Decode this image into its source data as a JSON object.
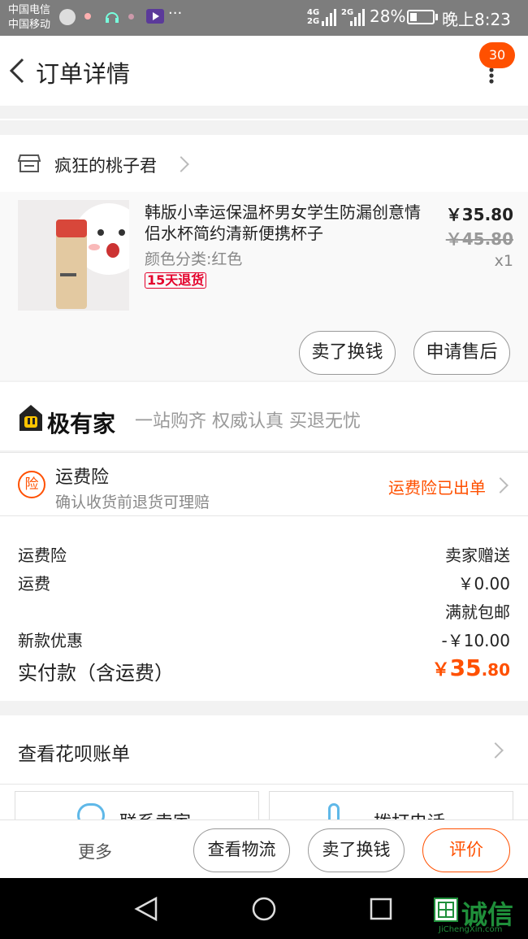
{
  "statusbar": {
    "carrier1": "中国电信",
    "carrier2": "中国移动",
    "network1": "4G",
    "network1b": "2G",
    "network2": "2G",
    "battery": "28%",
    "time": "晚上8:23"
  },
  "header": {
    "title": "订单详情",
    "badge_count": "30"
  },
  "shop": {
    "name": "疯狂的桃子君"
  },
  "product": {
    "title": "韩版小幸运保温杯男女学生防漏创意情侣水杯简约清新便携杯子",
    "variant": "颜色分类:红色",
    "return_tag": "15天退货",
    "price": "￥35.80",
    "original_price": "￥45.80",
    "quantity": "x1"
  },
  "product_actions": {
    "exchange": "卖了换钱",
    "after_sale": "申请售后"
  },
  "brand_banner": {
    "name": "极有家",
    "slogan": "一站购齐 权威认真 买退无忧"
  },
  "insurance": {
    "icon_char": "险",
    "title": "运费险",
    "subtitle": "确认收货前退货可理赔",
    "status": "运费险已出单"
  },
  "costs": {
    "rows": [
      {
        "label": "运费险",
        "value": "卖家赠送"
      },
      {
        "label": "运费",
        "value": "￥0.00"
      },
      {
        "label": "",
        "value": "满就包邮"
      },
      {
        "label": "新款优惠",
        "value": "-￥10.00"
      }
    ],
    "total_label": "实付款（含运费）",
    "total_currency": "￥",
    "total_int": "35",
    "total_dec": ".80"
  },
  "huabei": {
    "label": "查看花呗账单"
  },
  "contact": {
    "seller": "联系卖家",
    "call": "拨打电话"
  },
  "bottom_bar": {
    "more": "更多",
    "logistics": "查看物流",
    "exchange": "卖了换钱",
    "review": "评价"
  },
  "watermark": {
    "text": "诚信",
    "url": "JiChengXin.com"
  },
  "colors": {
    "accent": "#ff5000",
    "status_bar": "#7d7d7d",
    "nav_bar": "#000000"
  }
}
